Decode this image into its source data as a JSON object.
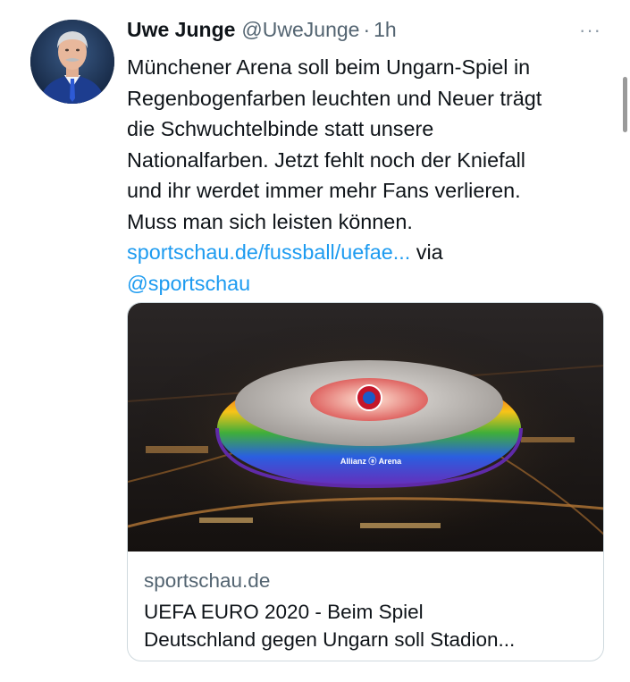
{
  "tweet": {
    "display_name": "Uwe Junge",
    "handle": "@UweJunge",
    "separator": "·",
    "time": "1h",
    "more_label": "···",
    "text_lines": [
      "Münchener Arena soll beim Ungarn-Spiel in",
      "Regenbogenfarben leuchten und Neuer trägt",
      "die Schwuchtelbinde statt unsere",
      "Nationalfarben. Jetzt fehlt noch der Kniefall",
      "und ihr werdet immer mehr Fans verlieren.",
      "Muss man sich leisten können."
    ],
    "link_text": "sportschau.de/fussball/uefae...",
    "via_text": " via",
    "mention": "@sportschau"
  },
  "card": {
    "image_text": "Allianz ⓐ Arena",
    "domain": "sportschau.de",
    "title_lines": [
      "UEFA EURO 2020 - Beim Spiel",
      "Deutschland gegen Ungarn soll Stadion..."
    ]
  },
  "colors": {
    "link": "#1d9bf0",
    "secondary": "#536471",
    "border": "#cfd9de"
  }
}
